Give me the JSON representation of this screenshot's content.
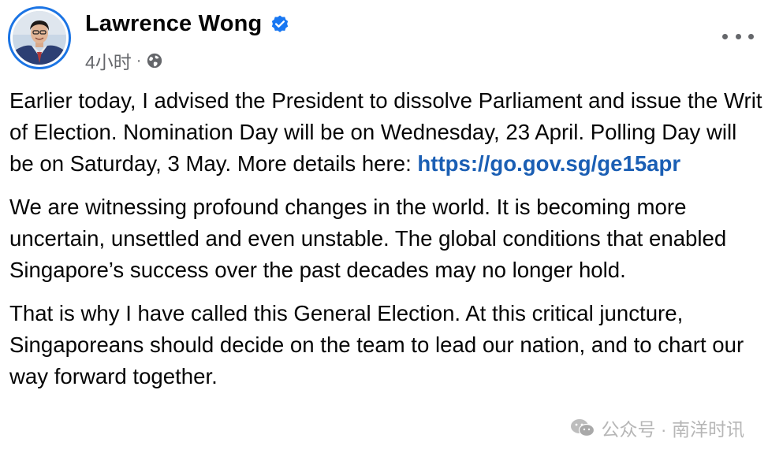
{
  "post": {
    "author": "Lawrence Wong",
    "timestamp": "4小时",
    "separator": "·",
    "verified_icon": "verified-badge-icon",
    "privacy_icon": "globe-icon",
    "more_icon": "more-options-icon",
    "paragraphs": [
      {
        "text": "Earlier today, I advised the President to dissolve Parliament and issue the Writ of Election. Nomination Day will be on Wednesday, 23 April. Polling Day will be on Saturday, 3 May. More details here: ",
        "link": "https://go.gov.sg/ge15apr"
      },
      {
        "text": "We are witnessing profound changes in the world. It is becoming more uncertain, unsettled and even unstable. The global conditions that enabled Singapore’s success over the past decades may no longer hold."
      },
      {
        "text": "That is why I have called this General Election. At this critical juncture, Singaporeans should decide on the team to lead our nation, and to chart our way forward together."
      }
    ]
  },
  "watermark": {
    "text": "公众号 · 南洋时讯",
    "icon": "wechat-icon"
  },
  "colors": {
    "link": "#1b5fb4",
    "verified": "#1877f2",
    "secondary_text": "#65676b",
    "avatar_ring": "#1b74e4"
  }
}
